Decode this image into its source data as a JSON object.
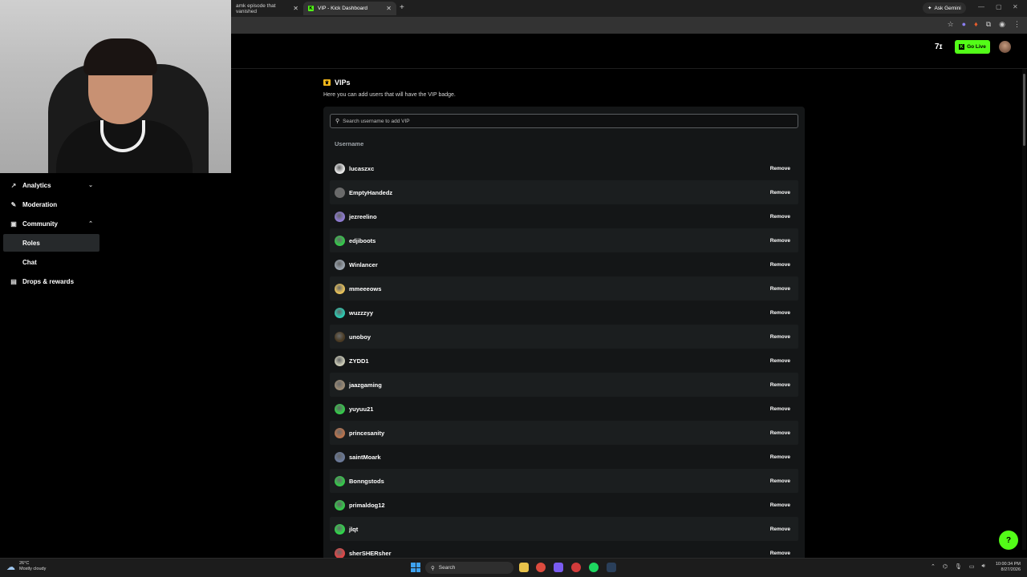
{
  "browser": {
    "tabs": [
      {
        "title": "amk episode that vanished"
      },
      {
        "title": "VIP - Kick Dashboard"
      }
    ],
    "new_tab": "+",
    "ask_gemini": "Ask Gemini"
  },
  "header": {
    "go_live_label": "Go Live"
  },
  "sidebar": {
    "items": [
      {
        "label": "Analytics",
        "icon": "chart-icon",
        "chevron": "⌄"
      },
      {
        "label": "Moderation",
        "icon": "wrench-icon"
      },
      {
        "label": "Community",
        "icon": "community-icon",
        "chevron": "⌃"
      },
      {
        "label": "Roles",
        "active": true
      },
      {
        "label": "Chat"
      },
      {
        "label": "Drops & rewards",
        "icon": "gift-icon"
      }
    ]
  },
  "vip": {
    "title": "VIPs",
    "description": "Here you can add users that will have the VIP badge.",
    "search_placeholder": "Search username to add VIP",
    "column_header": "Username",
    "remove_label": "Remove",
    "users": [
      {
        "name": "lucaszxc",
        "avatar_color": "#e8e8e8"
      },
      {
        "name": "EmptyHandedz",
        "avatar_color": "#6b6b6b"
      },
      {
        "name": "jezreelino",
        "avatar_color": "#8e7bd1"
      },
      {
        "name": "edjiboots",
        "avatar_color": "#35c84a"
      },
      {
        "name": "Winlancer",
        "avatar_color": "#9aa3ad"
      },
      {
        "name": "mmeeeows",
        "avatar_color": "#e7c15a"
      },
      {
        "name": "wuzzzyy",
        "avatar_color": "#2ec8b0"
      },
      {
        "name": "unoboy",
        "avatar_color": "#4a3a22"
      },
      {
        "name": "ZYDD1",
        "avatar_color": "#c9c9b5"
      },
      {
        "name": "jaazgaming",
        "avatar_color": "#9b8a74"
      },
      {
        "name": "yuyuu21",
        "avatar_color": "#35c84a"
      },
      {
        "name": "princesanity",
        "avatar_color": "#b8734d"
      },
      {
        "name": "saintMoark",
        "avatar_color": "#6b7a99"
      },
      {
        "name": "Bonngstods",
        "avatar_color": "#35c84a"
      },
      {
        "name": "primaldog12",
        "avatar_color": "#35c84a"
      },
      {
        "name": "jlqt",
        "avatar_color": "#2fd64a"
      },
      {
        "name": "sherSHERsher",
        "avatar_color": "#e04848"
      }
    ]
  },
  "taskbar": {
    "weather_temp": "26°C",
    "weather_desc": "Mostly cloudy",
    "search_label": "Search",
    "time": "10:00:34 PM",
    "date": "8/27/2026"
  },
  "colors": {
    "accent": "#53fc18",
    "vip_badge": "#f6b91b",
    "panel_bg": "#141617",
    "row_alt": "#1b1e1f"
  }
}
